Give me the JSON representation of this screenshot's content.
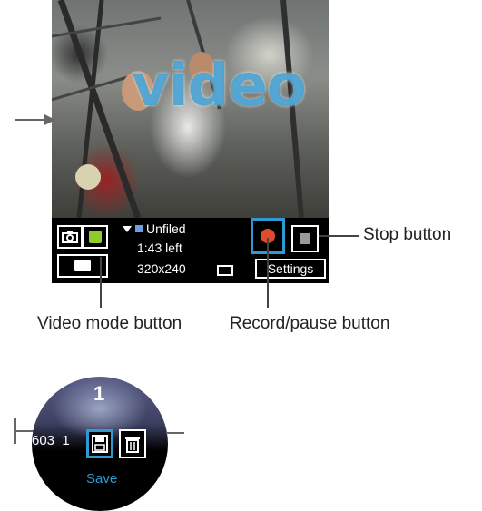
{
  "viewfinder": {
    "mode_watermark": "video"
  },
  "status": {
    "album": "Unfiled",
    "time_left": "1:43 left",
    "resolution": "320x240"
  },
  "controls": {
    "settings_label": "Settings"
  },
  "callouts": {
    "stop": "Stop button",
    "video_mode": "Video mode button",
    "record_pause": "Record/pause button"
  },
  "zoom": {
    "counter": "1",
    "filename": "603_1",
    "save_label": "Save"
  },
  "colors": {
    "accent_blue": "#2d9ad3",
    "record_red": "#e04b2c",
    "video_green": "#8dcc2c"
  }
}
